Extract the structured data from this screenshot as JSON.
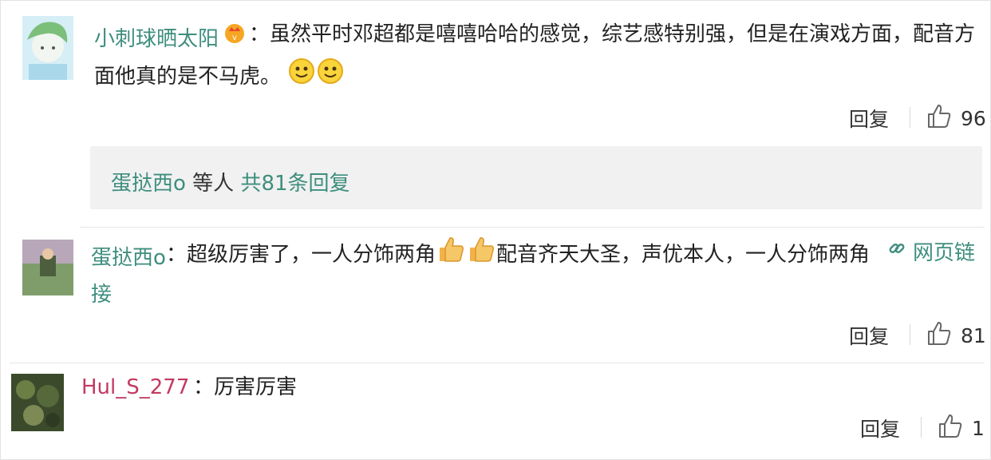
{
  "comments": [
    {
      "user": "小刺球晒太阳",
      "badge_icon": "vip-badge-icon",
      "text_line1": "：虽然平时邓超都是嘻嘻哈哈的感觉，综艺感特别强，但是在演戏方面，配音方",
      "text_line2": "面他真的是不马虎。",
      "text_emoji": "smile-emoji",
      "reply_label": "回复",
      "like_count": "96"
    },
    {
      "user": "蛋挞西o",
      "text_part1": "：超级厉害了，一人分饰两角",
      "text_emoji": "thumbs-up-emoji",
      "text_part2": "配音齐天大圣，声优本人，一人分饰两角",
      "weblink_label": "网页链",
      "text_line2": "接",
      "reply_label": "回复",
      "like_count": "81"
    },
    {
      "user": "Hul_S_277",
      "text": "：厉害厉害",
      "reply_label": "回复",
      "like_count": "1"
    }
  ],
  "reply_summary": {
    "user": "蛋挞西o",
    "middle": " 等人 ",
    "count_text": "共81条回复"
  },
  "colors": {
    "username_green": "#3e8e7e",
    "username_pink": "#c23a62"
  }
}
